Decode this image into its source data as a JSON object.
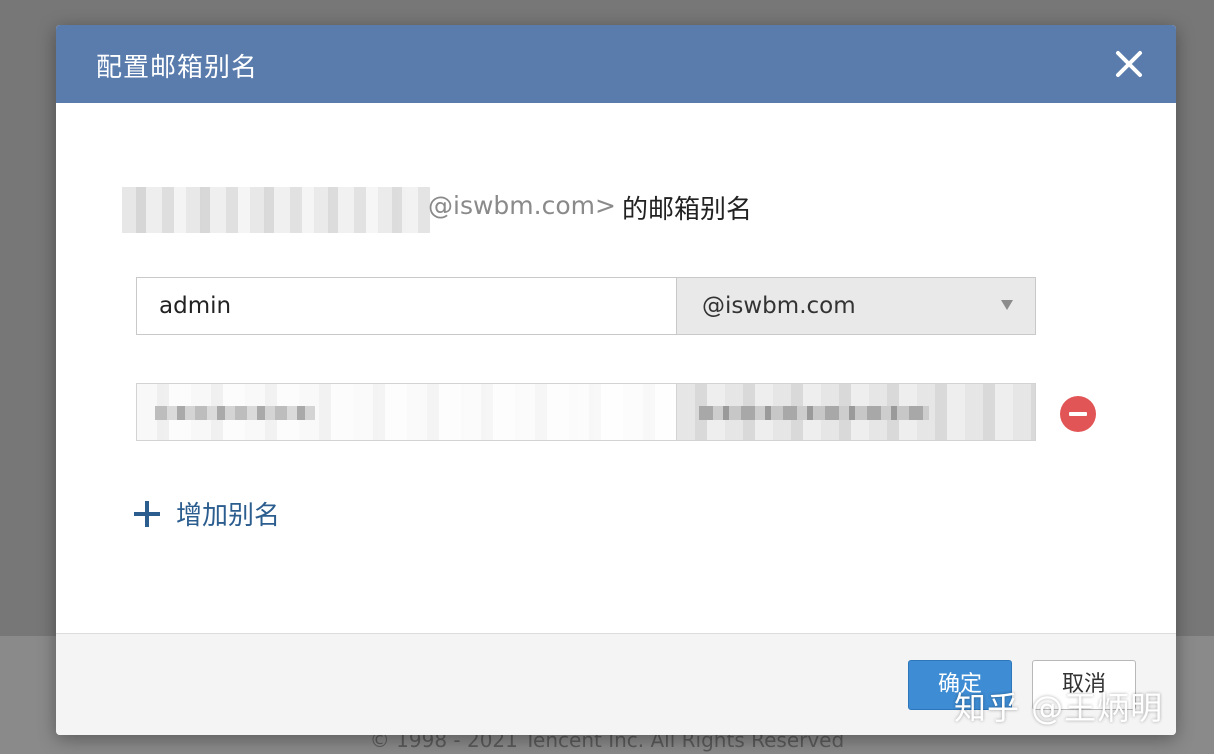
{
  "dialog": {
    "title": "配置邮箱别名",
    "description_domain": "@iswbm.com>",
    "description_suffix": "的邮箱别名",
    "alias_row": {
      "input_value": "admin",
      "domain_selected": "@iswbm.com"
    },
    "add_alias_label": "增加别名",
    "confirm_label": "确定",
    "cancel_label": "取消"
  },
  "page": {
    "footer": "© 1998 - 2021 Tencent Inc. All Rights Reserved"
  },
  "watermark": "知乎 @王炳明",
  "icons": {
    "close": "close-icon",
    "remove": "minus-circle-icon",
    "add": "plus-icon",
    "dropdown": "chevron-down-icon"
  },
  "colors": {
    "header": "#5a7cad",
    "primary_button": "#3e8cd3",
    "remove": "#e25556",
    "link": "#2b5d8f"
  }
}
